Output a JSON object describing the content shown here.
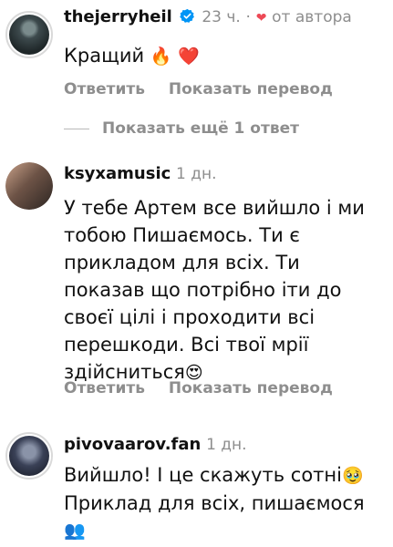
{
  "comments": [
    {
      "username": "thejerryheil",
      "time": "23 ч.",
      "separator": "·",
      "by_author_label": "от автора",
      "text": "Кращий",
      "emojis": [
        "🔥",
        "❤️"
      ],
      "reply_label": "Ответить",
      "translate_label": "Показать перевод",
      "avatar_icon": "profile-photo"
    },
    {
      "username": "ksyxamusic",
      "time": "1 дн.",
      "text": "У тебе Артем все вийшло і ми тобою Пишаємось.  Ти є прикладом для всіх. Ти показав що потрібно іти до своєї цілі і проходити всі перешкоди. Всі твої мрії здійсниться",
      "emoji_end": "😍",
      "reply_label": "Ответить",
      "translate_label": "Показать перевод",
      "avatar_icon": "profile-photo"
    },
    {
      "username": "pivovaarov.fan",
      "time": "1 дн.",
      "line1": "Вийшло! І це скажуть сотні",
      "line1_emoji": "🥹",
      "line2": "Приклад для всіх, пишаємося",
      "line3_emoji": "👥",
      "avatar_icon": "profile-photo"
    }
  ],
  "more_replies_label": "Показать ещё 1 ответ",
  "colors": {
    "text": "#111111",
    "muted": "#8e8e8e",
    "verified": "#0095f6",
    "heart": "#ed4956"
  }
}
